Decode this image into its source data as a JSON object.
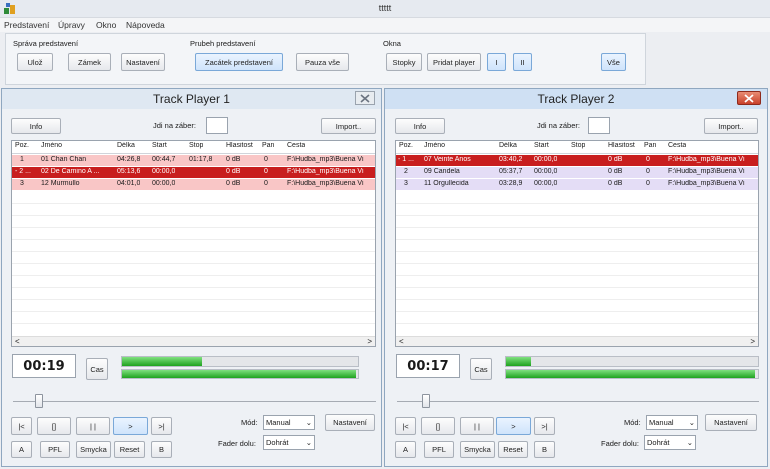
{
  "app": {
    "title": "ttttt"
  },
  "menu": [
    "Predstavení",
    "Úpravy",
    "Okno",
    "Nápoveda"
  ],
  "toolbar": {
    "group1": {
      "title": "Správa predstavení",
      "buttons": [
        "Ulož",
        "Zámek",
        "Nastavení"
      ]
    },
    "group2": {
      "title": "Prubeh predstavení",
      "buttons": [
        "Zacátek predstavení",
        "Pauza vše"
      ]
    },
    "group3": {
      "title": "Okna",
      "buttons": [
        "Stopky",
        "Pridat player",
        "I",
        "II",
        "Vše"
      ]
    }
  },
  "columns": [
    "Poz.",
    "Jméno",
    "Délka",
    "Start",
    "Stop",
    "Hlasitost",
    "Pan",
    "Cesta"
  ],
  "players": [
    {
      "title": "Track Player 1",
      "info_label": "Info",
      "goto_label": "Jdi na záber:",
      "goto_value": "",
      "import_label": "Import..",
      "rows": [
        {
          "pos": "1",
          "name": "01 Chan Chan",
          "length": "04:26,8",
          "start": "00:44,7",
          "stop": "01:17,8",
          "volume": "0 dB",
          "pan": "0",
          "path": "F:\\Hudba_mp3\\Buena Vi"
        },
        {
          "pos": "- 2 ...",
          "name": "02 De Camino A ...",
          "length": "05:13,6",
          "start": "00:00,0",
          "stop": "",
          "volume": "0 dB",
          "pan": "0",
          "path": "F:\\Hudba_mp3\\Buena Vi"
        },
        {
          "pos": "3",
          "name": "12 Murmullo",
          "length": "04:01,0",
          "start": "00:00,0",
          "stop": "",
          "volume": "0 dB",
          "pan": "0",
          "path": "F:\\Hudba_mp3\\Buena Vi"
        }
      ],
      "time": "00:19",
      "cas_label": "Cas",
      "meter_levels": [
        0.34,
        0.99
      ],
      "transport": [
        "|<",
        "[]",
        "| |",
        ">",
        ">|"
      ],
      "bottom_buttons": [
        "A",
        "PFL",
        "Smycka",
        "Reset",
        "B"
      ],
      "mode_label": "Mód:",
      "mode_value": "Manual",
      "fader_label": "Fader dolu:",
      "fader_value": "Dohrát",
      "settings_label": "Nastavení",
      "close_icon": "close-icon-inactive"
    },
    {
      "title": "Track Player 2",
      "info_label": "Info",
      "goto_label": "Jdi na záber:",
      "goto_value": "",
      "import_label": "Import..",
      "rows": [
        {
          "pos": "- 1 ...",
          "name": "07 Veinte Anos",
          "length": "03:40,2",
          "start": "00:00,0",
          "stop": "",
          "volume": "0 dB",
          "pan": "0",
          "path": "F:\\Hudba_mp3\\Buena Vi"
        },
        {
          "pos": "2",
          "name": "09 Candela",
          "length": "05:37,7",
          "start": "00:00,0",
          "stop": "",
          "volume": "0 dB",
          "pan": "0",
          "path": "F:\\Hudba_mp3\\Buena Vi"
        },
        {
          "pos": "3",
          "name": "11 Orgullecida",
          "length": "03:28,9",
          "start": "00:00,0",
          "stop": "",
          "volume": "0 dB",
          "pan": "0",
          "path": "F:\\Hudba_mp3\\Buena Vi"
        }
      ],
      "time": "00:17",
      "cas_label": "Cas",
      "meter_levels": [
        0.1,
        0.99
      ],
      "transport": [
        "|<",
        "[]",
        "| |",
        ">",
        ">|"
      ],
      "bottom_buttons": [
        "A",
        "PFL",
        "Smycka",
        "Reset",
        "B"
      ],
      "mode_label": "Mód:",
      "mode_value": "Manual",
      "fader_label": "Fader dolu:",
      "fader_value": "Dohrát",
      "settings_label": "Nastavení",
      "close_icon": "close-icon-active"
    }
  ],
  "colors": {
    "playing_row": "#c81e1e",
    "cued_row": "#f9c6c6",
    "p2_rows": "#e4ddf6",
    "accent": "#cfe4fb"
  }
}
